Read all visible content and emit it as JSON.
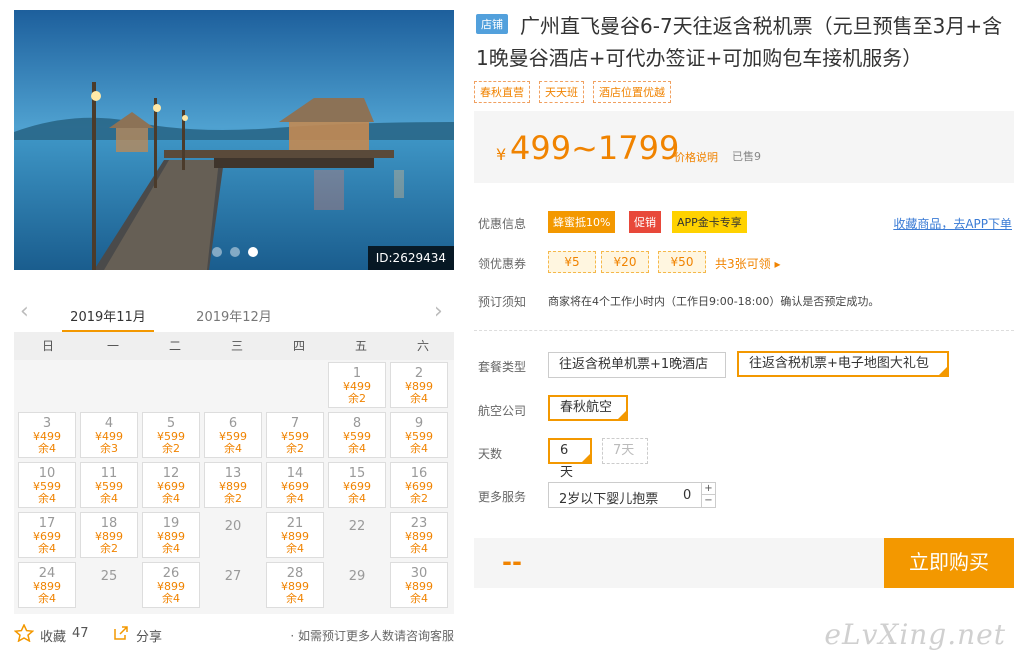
{
  "photo": {
    "id_label": "ID:2629434",
    "slides": 3,
    "active_slide": 3
  },
  "calendar": {
    "tabs": [
      "2019年11月",
      "2019年12月"
    ],
    "weekdays": [
      "日",
      "一",
      "二",
      "三",
      "四",
      "五",
      "六"
    ],
    "days": [
      {
        "d": "1",
        "p": "¥499",
        "s": "余2"
      },
      {
        "d": "2",
        "p": "¥899",
        "s": "余4"
      },
      {
        "d": "3",
        "p": "¥499",
        "s": "余4"
      },
      {
        "d": "4",
        "p": "¥499",
        "s": "余3"
      },
      {
        "d": "5",
        "p": "¥599",
        "s": "余2"
      },
      {
        "d": "6",
        "p": "¥599",
        "s": "余4"
      },
      {
        "d": "7",
        "p": "¥599",
        "s": "余2"
      },
      {
        "d": "8",
        "p": "¥599",
        "s": "余4"
      },
      {
        "d": "9",
        "p": "¥599",
        "s": "余4"
      },
      {
        "d": "10",
        "p": "¥599",
        "s": "余4"
      },
      {
        "d": "11",
        "p": "¥599",
        "s": "余4"
      },
      {
        "d": "12",
        "p": "¥699",
        "s": "余4"
      },
      {
        "d": "13",
        "p": "¥899",
        "s": "余2"
      },
      {
        "d": "14",
        "p": "¥699",
        "s": "余4"
      },
      {
        "d": "15",
        "p": "¥699",
        "s": "余4"
      },
      {
        "d": "16",
        "p": "¥699",
        "s": "余2"
      },
      {
        "d": "17",
        "p": "¥699",
        "s": "余4"
      },
      {
        "d": "18",
        "p": "¥899",
        "s": "余2"
      },
      {
        "d": "19",
        "p": "¥899",
        "s": "余4"
      },
      {
        "d": "20",
        "p": "",
        "s": ""
      },
      {
        "d": "21",
        "p": "¥899",
        "s": "余4"
      },
      {
        "d": "22",
        "p": "",
        "s": ""
      },
      {
        "d": "23",
        "p": "¥899",
        "s": "余4"
      },
      {
        "d": "24",
        "p": "¥899",
        "s": "余4"
      },
      {
        "d": "25",
        "p": "",
        "s": ""
      },
      {
        "d": "26",
        "p": "¥899",
        "s": "余4"
      },
      {
        "d": "27",
        "p": "",
        "s": ""
      },
      {
        "d": "28",
        "p": "¥899",
        "s": "余4"
      },
      {
        "d": "29",
        "p": "",
        "s": ""
      },
      {
        "d": "30",
        "p": "¥899",
        "s": "余4"
      }
    ]
  },
  "footer": {
    "fav_label": "收藏",
    "fav_count": "47",
    "share_label": "分享",
    "consult": "· 如需预订更多人数请咨询客服"
  },
  "product": {
    "store_badge": "店铺",
    "title": "广州直飞曼谷6-7天往返含税机票（元旦预售至3月+含1晚曼谷酒店+可代办签证+可加购包车接机服务）",
    "tags": [
      "春秋直营",
      "天天班",
      "酒店位置优越"
    ],
    "price_symbol": "¥",
    "price": "499~1799",
    "price_explain": "价格说明",
    "sold": "已售9"
  },
  "offers": {
    "label": "优惠信息",
    "promos": [
      "蜂蜜抵10%",
      "促销",
      "APP金卡专享"
    ],
    "app_link": "收藏商品，去APP下单"
  },
  "coupons": {
    "label": "领优惠券",
    "items": [
      "¥5",
      "¥20",
      "¥50"
    ],
    "more": "共3张可领 ▸"
  },
  "notice": {
    "label": "预订须知",
    "text": "商家将在4个工作小时内（工作日9:00-18:00）确认是否预定成功。"
  },
  "package": {
    "label": "套餐类型",
    "options": [
      "往返含税单机票+1晚酒店",
      "往返含税机票+电子地图大礼包"
    ]
  },
  "airline": {
    "label": "航空公司",
    "options": [
      "春秋航空"
    ]
  },
  "days_opt": {
    "label": "天数",
    "options": [
      "6天",
      "7天"
    ]
  },
  "more_service": {
    "label": "更多服务",
    "stepper_label": "2岁以下婴儿抱票",
    "value": "0"
  },
  "buy": {
    "total": "--",
    "button": "立即购买"
  },
  "watermark": "eLvXing.net",
  "colors": {
    "accent": "#f39800",
    "price": "#f08300",
    "link": "#3a7bd5"
  }
}
